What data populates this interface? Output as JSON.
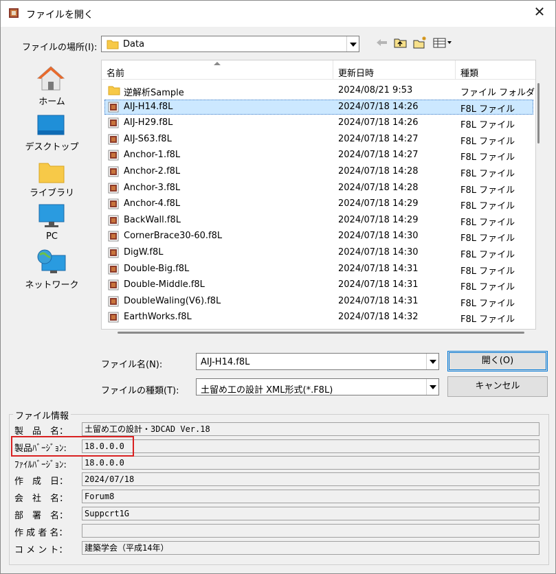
{
  "window": {
    "title": "ファイルを開く",
    "close_glyph": "✕"
  },
  "location": {
    "label": "ファイルの場所(I):",
    "value": "Data"
  },
  "places": [
    {
      "label": "ホーム",
      "icon": "home-icon"
    },
    {
      "label": "デスクトップ",
      "icon": "desktop-icon"
    },
    {
      "label": "ライブラリ",
      "icon": "library-folder-icon"
    },
    {
      "label": "PC",
      "icon": "pc-monitor-icon"
    },
    {
      "label": "ネットワーク",
      "icon": "network-globe-icon"
    }
  ],
  "columns": {
    "name": "名前",
    "date": "更新日時",
    "type": "種類"
  },
  "files": [
    {
      "name": "逆解析Sample",
      "date": "2024/08/21 9:53",
      "type": "ファイル フォルダー",
      "icon": "folder-icon"
    },
    {
      "name": "AIJ-H14.f8L",
      "date": "2024/07/18 14:26",
      "type": "F8L ファイル",
      "icon": "f8l-file-icon",
      "selected": true
    },
    {
      "name": "AIJ-H29.f8L",
      "date": "2024/07/18 14:26",
      "type": "F8L ファイル",
      "icon": "f8l-file-icon"
    },
    {
      "name": "AIJ-S63.f8L",
      "date": "2024/07/18 14:27",
      "type": "F8L ファイル",
      "icon": "f8l-file-icon"
    },
    {
      "name": "Anchor-1.f8L",
      "date": "2024/07/18 14:27",
      "type": "F8L ファイル",
      "icon": "f8l-file-icon"
    },
    {
      "name": "Anchor-2.f8L",
      "date": "2024/07/18 14:28",
      "type": "F8L ファイル",
      "icon": "f8l-file-icon"
    },
    {
      "name": "Anchor-3.f8L",
      "date": "2024/07/18 14:28",
      "type": "F8L ファイル",
      "icon": "f8l-file-icon"
    },
    {
      "name": "Anchor-4.f8L",
      "date": "2024/07/18 14:29",
      "type": "F8L ファイル",
      "icon": "f8l-file-icon"
    },
    {
      "name": "BackWall.f8L",
      "date": "2024/07/18 14:29",
      "type": "F8L ファイル",
      "icon": "f8l-file-icon"
    },
    {
      "name": "CornerBrace30-60.f8L",
      "date": "2024/07/18 14:30",
      "type": "F8L ファイル",
      "icon": "f8l-file-icon"
    },
    {
      "name": "DigW.f8L",
      "date": "2024/07/18 14:30",
      "type": "F8L ファイル",
      "icon": "f8l-file-icon"
    },
    {
      "name": "Double-Big.f8L",
      "date": "2024/07/18 14:31",
      "type": "F8L ファイル",
      "icon": "f8l-file-icon"
    },
    {
      "name": "Double-Middle.f8L",
      "date": "2024/07/18 14:31",
      "type": "F8L ファイル",
      "icon": "f8l-file-icon"
    },
    {
      "name": "DoubleWaling(V6).f8L",
      "date": "2024/07/18 14:31",
      "type": "F8L ファイル",
      "icon": "f8l-file-icon"
    },
    {
      "name": "EarthWorks.f8L",
      "date": "2024/07/18 14:32",
      "type": "F8L ファイル",
      "icon": "f8l-file-icon"
    }
  ],
  "filename": {
    "label": "ファイル名(N):",
    "value": "AIJ-H14.f8L"
  },
  "filetype": {
    "label": "ファイルの種類(T):",
    "value": "土留め工の設計 XML形式(*.F8L)"
  },
  "buttons": {
    "open": "開く(O)",
    "cancel": "キャンセル"
  },
  "info": {
    "title": "ファイル情報",
    "rows": [
      {
        "label": "製　品　名：",
        "value": "土留め工の設計・3DCAD Ver.18"
      },
      {
        "label": "製品ﾊﾞｰｼﾞｮﾝ:",
        "value": "18.0.0.0"
      },
      {
        "label": "ﾌｧｲﾙﾊﾞｰｼﾞｮﾝ:",
        "value": "18.0.0.0"
      },
      {
        "label": "作　成　日：",
        "value": "2024/07/18"
      },
      {
        "label": "会　社　名：",
        "value": "Forum8"
      },
      {
        "label": "部　署　名：",
        "value": "Suppcrt1G"
      },
      {
        "label": "作 成 者 名：",
        "value": ""
      },
      {
        "label": "コ メ ン ト：",
        "value": "建築学会（平成14年）"
      }
    ]
  },
  "colors": {
    "selection": "#cce8ff",
    "accent": "#0078d7",
    "highlight_box": "#d92020"
  }
}
